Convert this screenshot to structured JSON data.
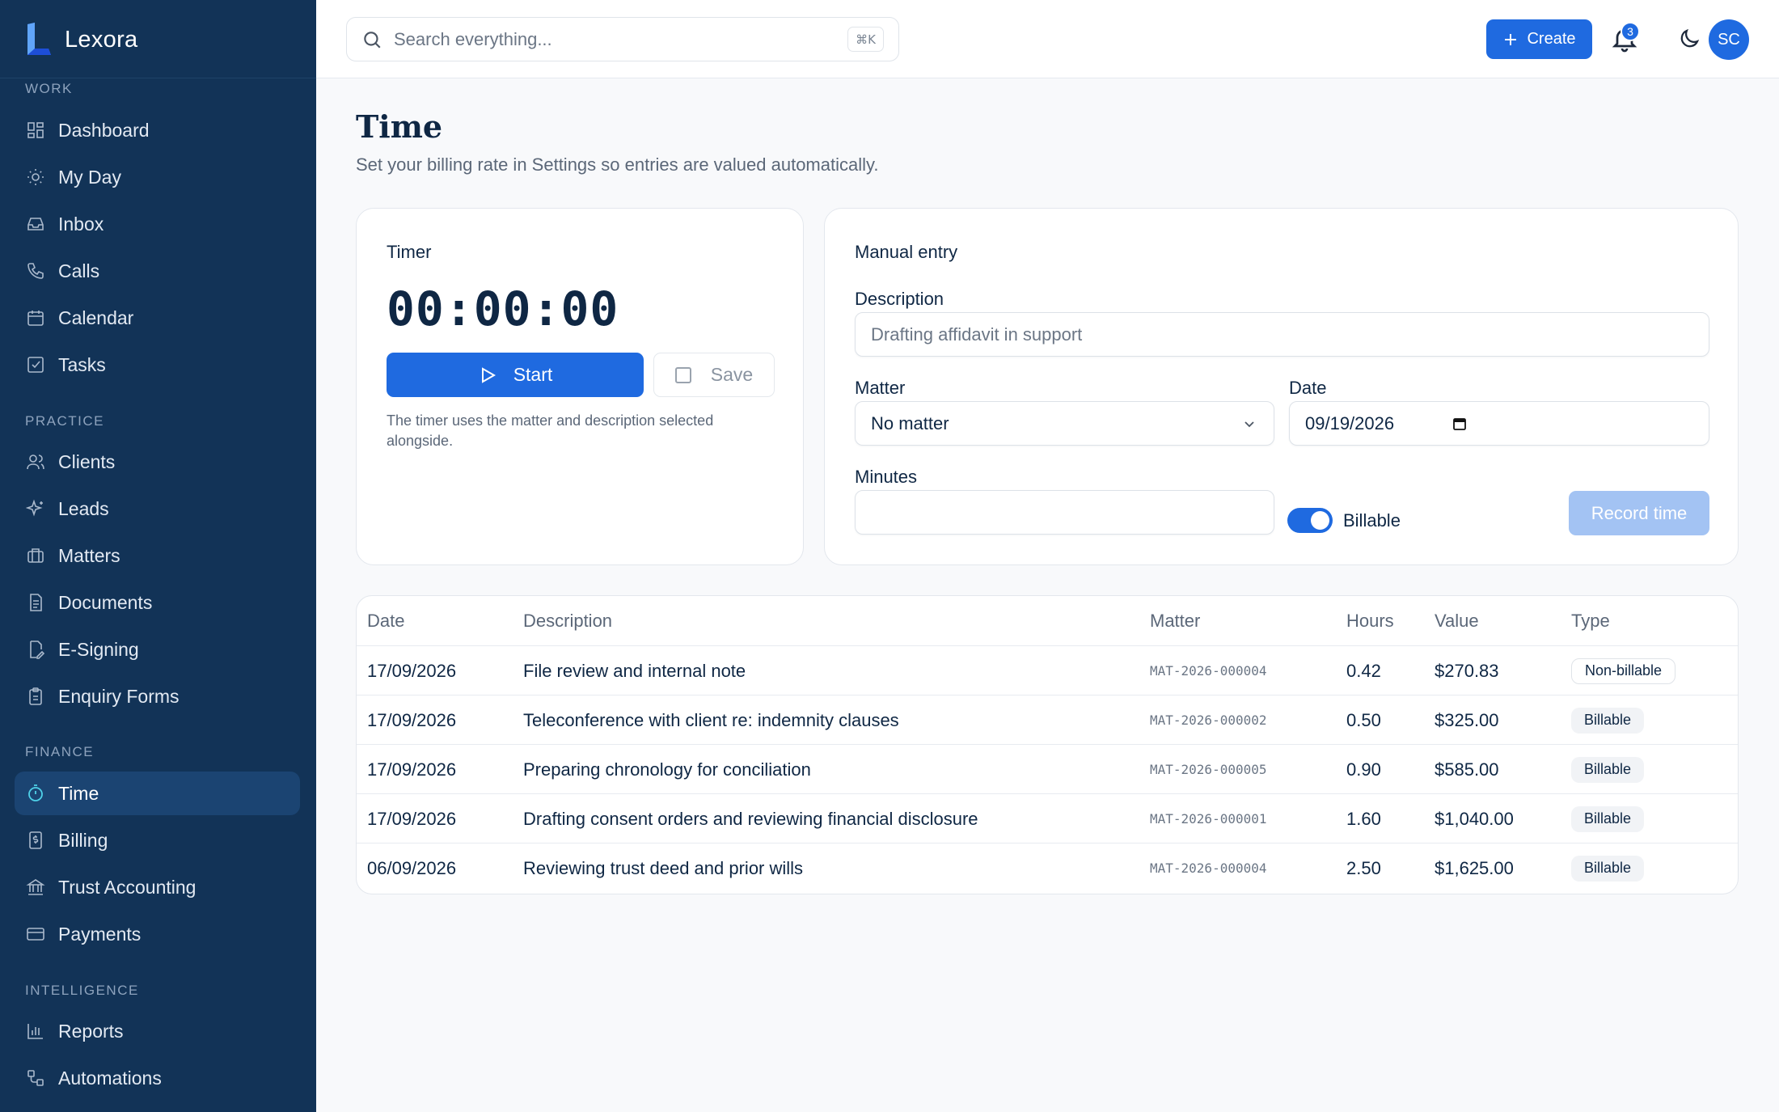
{
  "app": {
    "name": "Lexora"
  },
  "sidebar": {
    "sections": [
      {
        "label": "WORK",
        "items": [
          {
            "label": "Dashboard",
            "icon": "dashboard-icon"
          },
          {
            "label": "My Day",
            "icon": "sun-icon"
          },
          {
            "label": "Inbox",
            "icon": "inbox-icon"
          },
          {
            "label": "Calls",
            "icon": "phone-icon"
          },
          {
            "label": "Calendar",
            "icon": "calendar-icon"
          },
          {
            "label": "Tasks",
            "icon": "task-check-icon"
          }
        ]
      },
      {
        "label": "PRACTICE",
        "items": [
          {
            "label": "Clients",
            "icon": "users-icon"
          },
          {
            "label": "Leads",
            "icon": "sparkle-icon"
          },
          {
            "label": "Matters",
            "icon": "briefcase-icon"
          },
          {
            "label": "Documents",
            "icon": "document-icon"
          },
          {
            "label": "E-Signing",
            "icon": "signature-icon"
          },
          {
            "label": "Enquiry Forms",
            "icon": "clipboard-icon"
          }
        ]
      },
      {
        "label": "FINANCE",
        "items": [
          {
            "label": "Time",
            "icon": "timer-icon",
            "active": true
          },
          {
            "label": "Billing",
            "icon": "invoice-icon"
          },
          {
            "label": "Trust Accounting",
            "icon": "bank-icon"
          },
          {
            "label": "Payments",
            "icon": "credit-card-icon"
          }
        ]
      },
      {
        "label": "INTELLIGENCE",
        "items": [
          {
            "label": "Reports",
            "icon": "bar-chart-icon"
          },
          {
            "label": "Automations",
            "icon": "workflow-icon"
          }
        ]
      }
    ]
  },
  "topbar": {
    "search_placeholder": "Search everything...",
    "search_shortcut": "⌘K",
    "create_label": "Create",
    "notification_count": "3",
    "avatar_initials": "SC"
  },
  "page": {
    "title": "Time",
    "subtitle": "Set your billing rate in Settings so entries are valued automatically."
  },
  "timer": {
    "title": "Timer",
    "display": "00:00:00",
    "start_label": "Start",
    "save_label": "Save",
    "note": "The timer uses the matter and description selected alongside."
  },
  "manual": {
    "title": "Manual entry",
    "description_label": "Description",
    "description_placeholder": "Drafting affidavit in support",
    "matter_label": "Matter",
    "matter_value": "No matter",
    "date_label": "Date",
    "date_value": "09/19/2026",
    "minutes_label": "Minutes",
    "minutes_value": "",
    "billable_label": "Billable",
    "billable_on": true,
    "record_label": "Record time"
  },
  "table": {
    "headers": {
      "date": "Date",
      "description": "Description",
      "matter": "Matter",
      "hours": "Hours",
      "value": "Value",
      "type": "Type"
    },
    "rows": [
      {
        "date": "17/09/2026",
        "description": "File review and internal note",
        "matter": "MAT-2026-000004",
        "hours": "0.42",
        "value": "$270.83",
        "type": "Non-billable"
      },
      {
        "date": "17/09/2026",
        "description": "Teleconference with client re: indemnity clauses",
        "matter": "MAT-2026-000002",
        "hours": "0.50",
        "value": "$325.00",
        "type": "Billable"
      },
      {
        "date": "17/09/2026",
        "description": "Preparing chronology for conciliation",
        "matter": "MAT-2026-000005",
        "hours": "0.90",
        "value": "$585.00",
        "type": "Billable"
      },
      {
        "date": "17/09/2026",
        "description": "Drafting consent orders and reviewing financial disclosure",
        "matter": "MAT-2026-000001",
        "hours": "1.60",
        "value": "$1,040.00",
        "type": "Billable"
      },
      {
        "date": "06/09/2026",
        "description": "Reviewing trust deed and prior wills",
        "matter": "MAT-2026-000004",
        "hours": "2.50",
        "value": "$1,625.00",
        "type": "Billable"
      }
    ]
  },
  "colors": {
    "sidebar": "#123357",
    "accent": "#1f6ae0",
    "active_item": "#1b4472",
    "text": "#0f2744"
  }
}
